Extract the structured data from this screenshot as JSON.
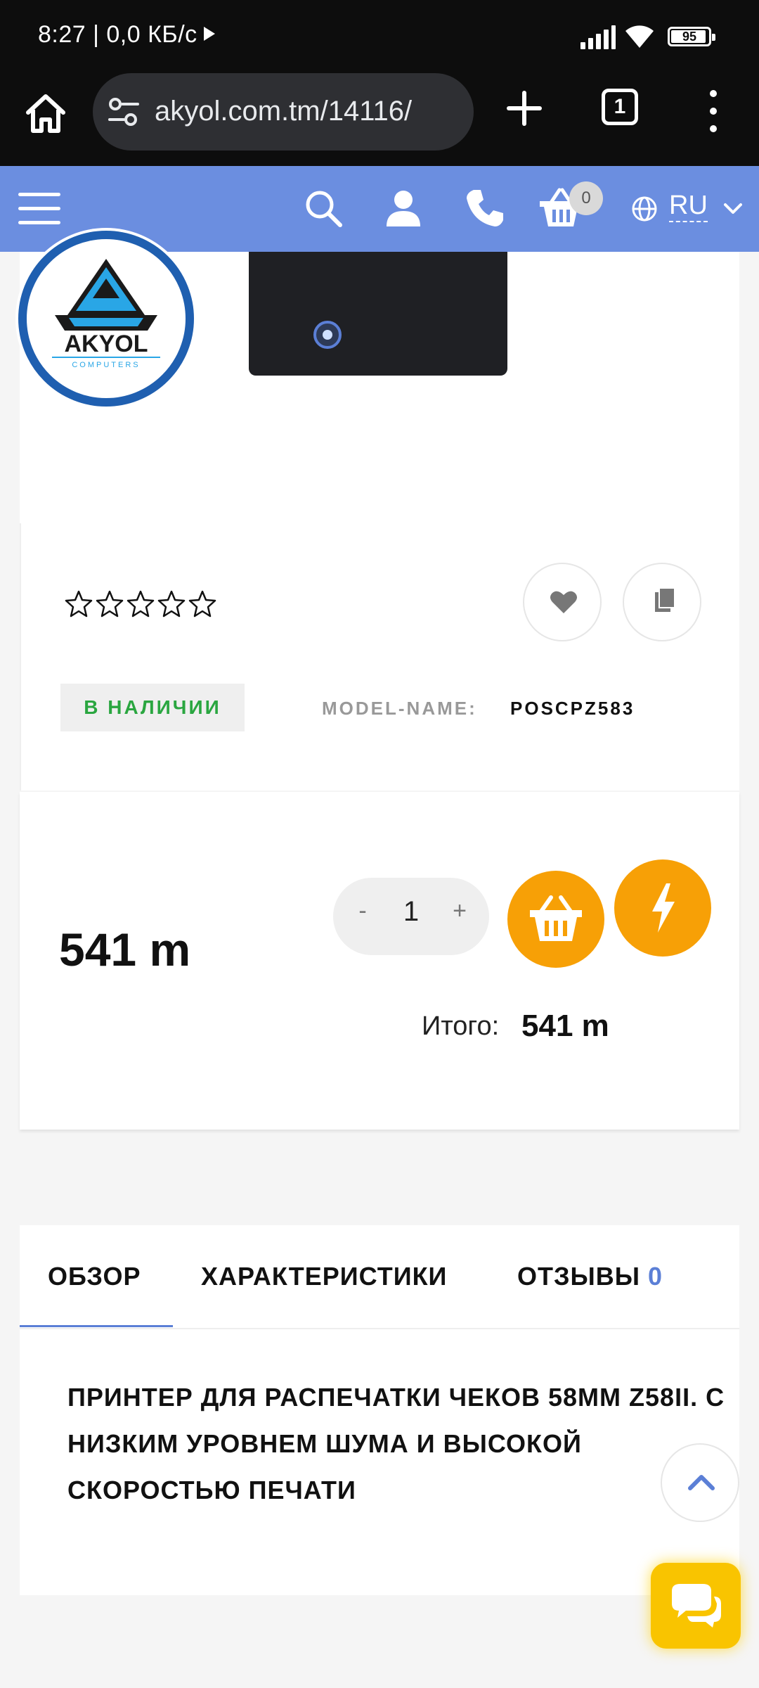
{
  "status_bar": {
    "time": "8:27 | 0,0 КБ/с",
    "battery": 95
  },
  "browser": {
    "url": "akyol.com.tm/14116/",
    "tab_count": "1"
  },
  "site_header": {
    "cart_count": "0",
    "language": "RU",
    "accent_color": "#6b8ee0"
  },
  "logo": {
    "brand": "AKYOL",
    "sub": "COMPUTERS"
  },
  "product": {
    "rating_stars": 5,
    "rating_value": 0,
    "stock_status": "В НАЛИЧИИ",
    "model_label": "MODEL-NAME:",
    "model_value": "POSCPZ583",
    "price": "541 m",
    "quantity": "1",
    "qty_minus": "-",
    "qty_plus": "+",
    "total_label": "Итого:",
    "total_value": "541 m"
  },
  "tabs": {
    "overview": "ОБЗОР",
    "specs": "ХАРАКТЕРИСТИКИ",
    "reviews": "ОТЗЫВЫ",
    "reviews_count": "0"
  },
  "description": "ПРИНТЕР ДЛЯ РАСПЕЧАТКИ ЧЕКОВ 58ММ Z58II. С НИЗКИМ УРОВНЕМ ШУМА И ВЫСОКОЙ СКОРОСТЬЮ ПЕЧАТИ",
  "colors": {
    "buy_orange": "#f7a006",
    "in_stock_green": "#2aa640",
    "chat_yellow": "#f9c400"
  },
  "icons": [
    "home-icon",
    "tune-icon",
    "plus-icon",
    "menu-icon",
    "hamburger-icon",
    "search-icon",
    "user-icon",
    "phone-icon",
    "cart-icon",
    "globe-icon",
    "chevron-down-icon",
    "heart-icon",
    "copy-icon",
    "basket-icon",
    "lightning-icon",
    "chevron-up-icon",
    "chat-icon"
  ]
}
